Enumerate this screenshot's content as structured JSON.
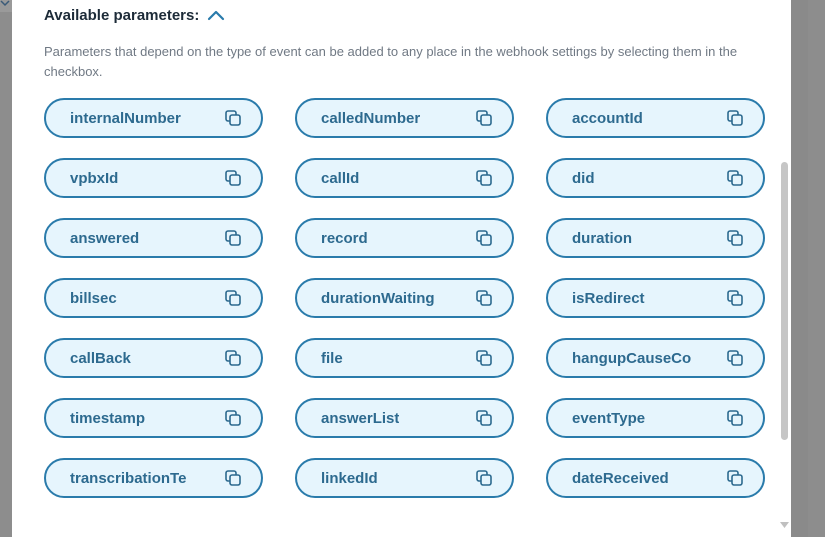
{
  "header": {
    "title": "Available parameters:"
  },
  "description": "Parameters that depend on the type of event can be added to any place in the webhook settings by selecting them in the checkbox.",
  "parameters": [
    "internalNumber",
    "calledNumber",
    "accountId",
    "vpbxId",
    "callId",
    "did",
    "answered",
    "record",
    "duration",
    "billsec",
    "durationWaiting",
    "isRedirect",
    "callBack",
    "file",
    "hangupCauseCo",
    "timestamp",
    "answerList",
    "eventType",
    "transcribationTe",
    "linkedId",
    "dateReceived"
  ],
  "icons": {
    "collapse": "chevron-up-icon",
    "copy": "copy-icon"
  },
  "colors": {
    "chip_border": "#2a7bab",
    "chip_bg": "#e6f5fd",
    "chip_text": "#2d6a8f",
    "title": "#1d2b38",
    "description": "#707984"
  }
}
